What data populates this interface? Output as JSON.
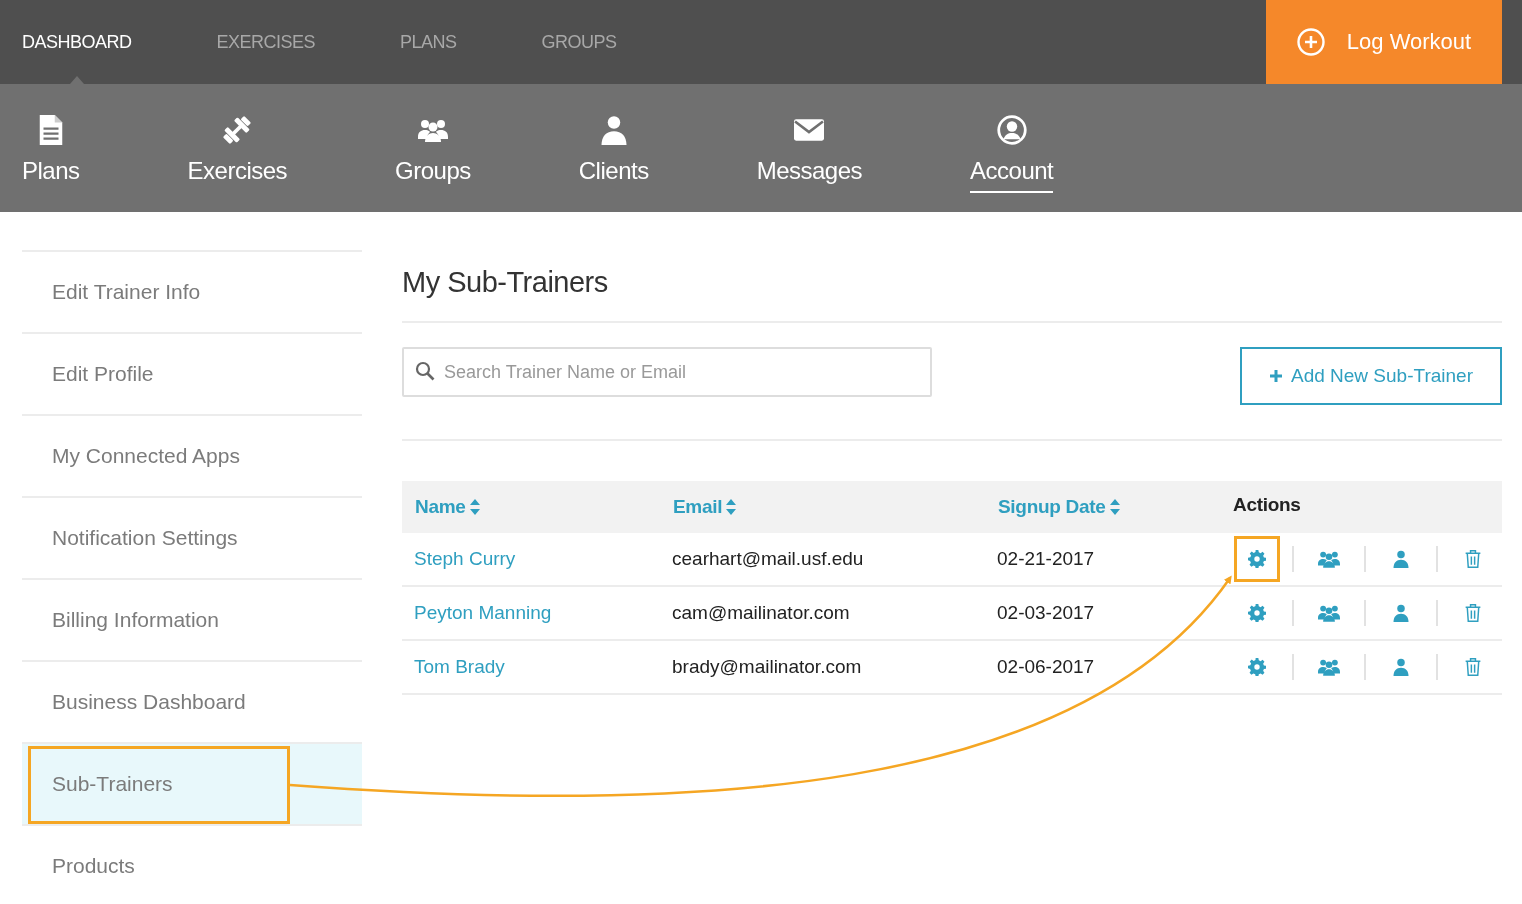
{
  "top_nav": {
    "tabs": [
      {
        "label": "DASHBOARD",
        "selected": true
      },
      {
        "label": "EXERCISES",
        "selected": false
      },
      {
        "label": "PLANS",
        "selected": false
      },
      {
        "label": "GROUPS",
        "selected": false
      }
    ],
    "action_button": {
      "label": "Log Workout"
    }
  },
  "sub_nav": [
    {
      "kind": "plans",
      "label": "Plans",
      "selected": false
    },
    {
      "kind": "exercises",
      "label": "Exercises",
      "selected": false
    },
    {
      "kind": "groups",
      "label": "Groups",
      "selected": false
    },
    {
      "kind": "clients",
      "label": "Clients",
      "selected": false
    },
    {
      "kind": "messages",
      "label": "Messages",
      "selected": false
    },
    {
      "kind": "account",
      "label": "Account",
      "selected": true
    }
  ],
  "sidebar": {
    "items": [
      {
        "label": "Edit Trainer Info",
        "selected": false,
        "callout": false
      },
      {
        "label": "Edit Profile",
        "selected": false,
        "callout": false
      },
      {
        "label": "My Connected Apps",
        "selected": false,
        "callout": false
      },
      {
        "label": "Notification Settings",
        "selected": false,
        "callout": false
      },
      {
        "label": "Billing Information",
        "selected": false,
        "callout": false
      },
      {
        "label": "Business Dashboard",
        "selected": false,
        "callout": false
      },
      {
        "label": "Sub-Trainers",
        "selected": true,
        "callout": true
      },
      {
        "label": "Products",
        "selected": false,
        "callout": false
      }
    ]
  },
  "main": {
    "title": "My Sub-Trainers",
    "search": {
      "placeholder": "Search Trainer Name or Email"
    },
    "add_button": {
      "label": "Add New Sub-Trainer"
    },
    "table": {
      "columns": [
        {
          "label": "Name",
          "sortable": true
        },
        {
          "label": "Email",
          "sortable": true
        },
        {
          "label": "Signup Date",
          "sortable": true
        },
        {
          "label": "Actions",
          "sortable": false
        }
      ],
      "rows": [
        {
          "name": "Steph Curry",
          "email": "cearhart@mail.usf.edu",
          "signup_date": "02-21-2017",
          "actions": [
            {
              "kind": "settings",
              "callout": true
            },
            {
              "kind": "groups",
              "callout": false
            },
            {
              "kind": "client",
              "callout": false
            },
            {
              "kind": "delete",
              "callout": false
            }
          ]
        },
        {
          "name": "Peyton Manning",
          "email": "cam@mailinator.com",
          "signup_date": "02-03-2017",
          "actions": [
            {
              "kind": "settings",
              "callout": false
            },
            {
              "kind": "groups",
              "callout": false
            },
            {
              "kind": "client",
              "callout": false
            },
            {
              "kind": "delete",
              "callout": false
            }
          ]
        },
        {
          "name": "Tom Brady",
          "email": "brady@mailinator.com",
          "signup_date": "02-06-2017",
          "actions": [
            {
              "kind": "settings",
              "callout": false
            },
            {
              "kind": "groups",
              "callout": false
            },
            {
              "kind": "client",
              "callout": false
            },
            {
              "kind": "delete",
              "callout": false
            }
          ]
        }
      ]
    }
  }
}
